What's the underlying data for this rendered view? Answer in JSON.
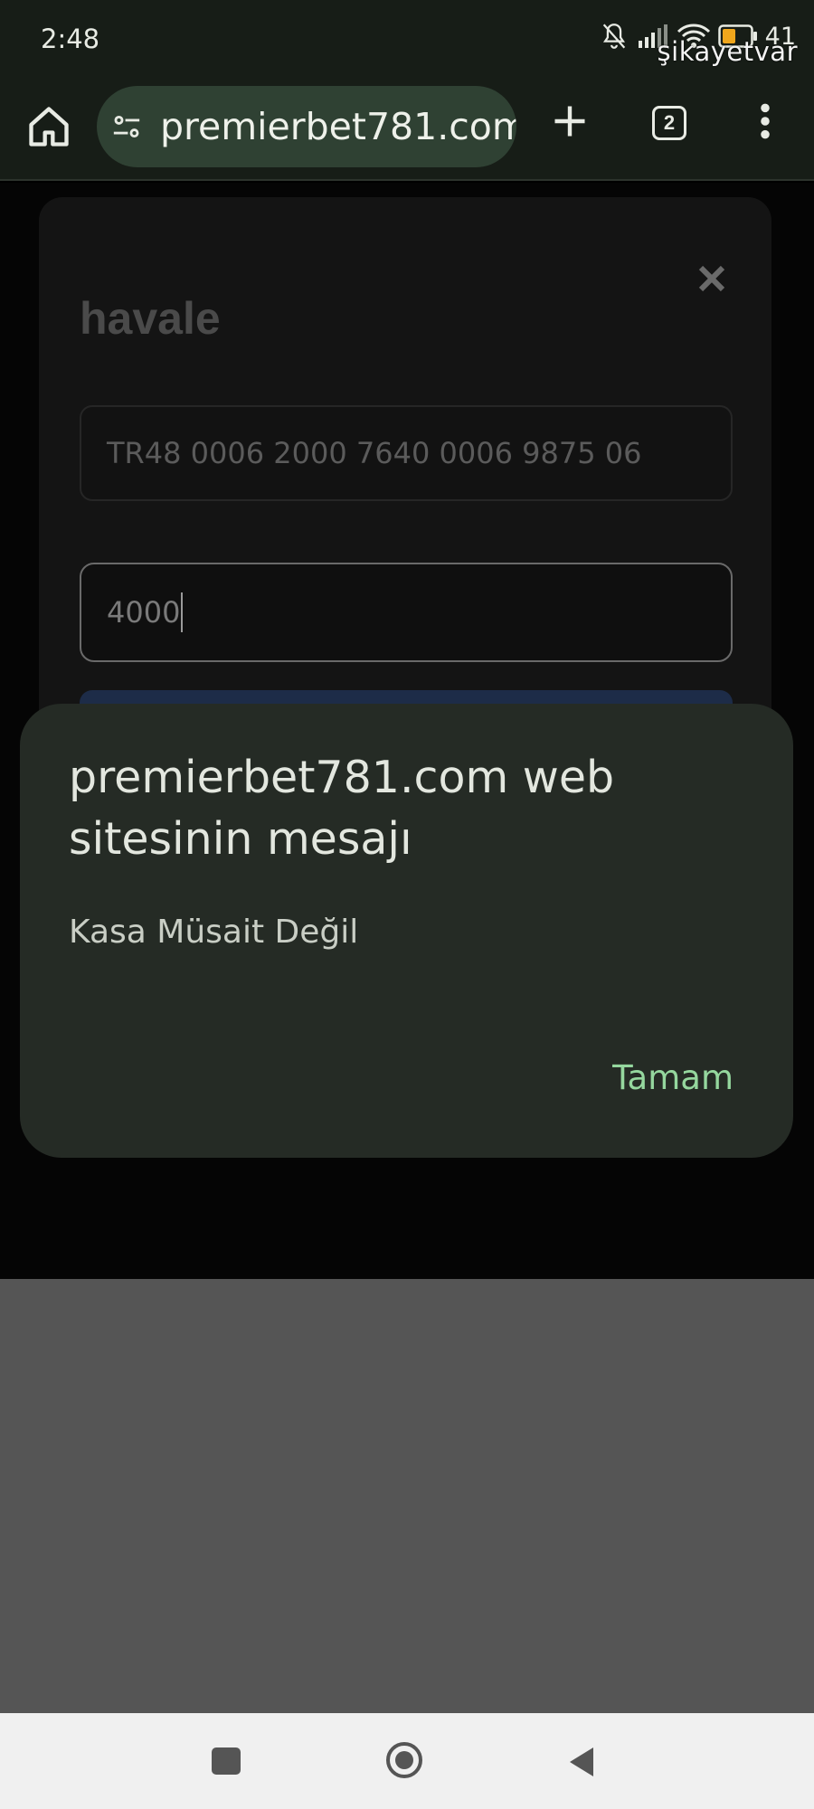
{
  "status_bar": {
    "time": "2:48",
    "battery": "41",
    "watermark": "şikayetvar"
  },
  "browser": {
    "url": "premierbet781.com/",
    "tab_count": "2",
    "icons": [
      "home-icon",
      "site-settings-icon",
      "plus-icon",
      "tabs-icon",
      "more-vert-icon"
    ]
  },
  "page": {
    "modal_title": "havale",
    "iban_value": "TR48 0006 2000 7640 0006 9875 06",
    "amount_value": "4000"
  },
  "alert": {
    "title": "premierbet781.com web sitesinin mesajı",
    "message": "Kasa Müsait Değil",
    "ok_label": "Tamam"
  },
  "colors": {
    "toolbar_bg": "#171d17",
    "url_pill_bg": "#2f4133",
    "dialog_bg": "#252b25",
    "dialog_ok": "#95d79e",
    "modal_bg": "#141414"
  }
}
